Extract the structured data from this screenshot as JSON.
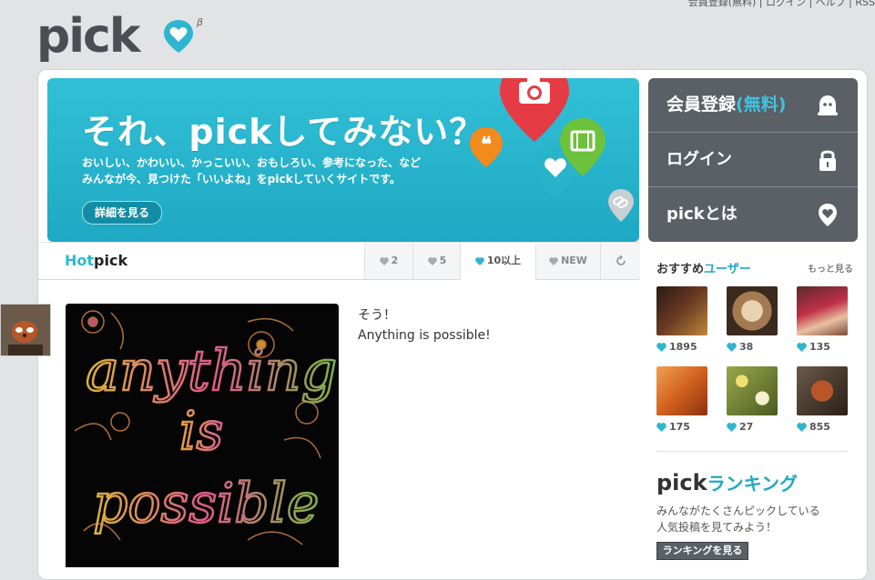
{
  "header": {
    "logo_text": "pick",
    "logo_beta": "β",
    "top_links": "会員登録(無料) | ログイン | ヘルプ | RSS"
  },
  "hero": {
    "title": "それ、pickしてみない？",
    "desc_line1": "おいしい、かわいい、かっこいい、おもしろい、参考になった、など",
    "desc_line2": "みんなが今、見つけた「いいよね」をpickしていくサイトです。",
    "details_button": "詳細を見る",
    "quote_glyph": "❝"
  },
  "menu": {
    "register_label": "会員登録",
    "register_accent": "(無料)",
    "login_label": "ログイン",
    "about_label": "pickとは"
  },
  "tabs": {
    "hot": "Hot",
    "pick": "pick",
    "items": [
      {
        "label": "2"
      },
      {
        "label": "5"
      },
      {
        "label": "10以上"
      },
      {
        "label": "NEW"
      }
    ]
  },
  "post": {
    "line1": "そう！",
    "line2": "Anything is possible!",
    "image_text_1": "anything",
    "image_text_2": "is",
    "image_text_3": "possible"
  },
  "recommend": {
    "title_prefix": "おすすめ",
    "title_accent": "ユーザー",
    "more_link": "もっと見る",
    "users": [
      {
        "count": "1895",
        "color": "#5a2a1a"
      },
      {
        "count": "38",
        "color": "#c8a27a"
      },
      {
        "count": "135",
        "color": "#a03040"
      },
      {
        "count": "175",
        "color": "#d2611e"
      },
      {
        "count": "27",
        "color": "#7a8a3a"
      },
      {
        "count": "855",
        "color": "#4a3a30"
      }
    ]
  },
  "ranking": {
    "title_prefix": "pick",
    "title_accent": "ランキング",
    "desc_line1": "みんながたくさんピックしている",
    "desc_line2": "人気投稿を見てみよう！",
    "button": "ランキングを見る"
  },
  "colors": {
    "accent": "#1fa8c3",
    "hero_bg": "#31c0d6",
    "menu_bg": "#5b5f66"
  }
}
